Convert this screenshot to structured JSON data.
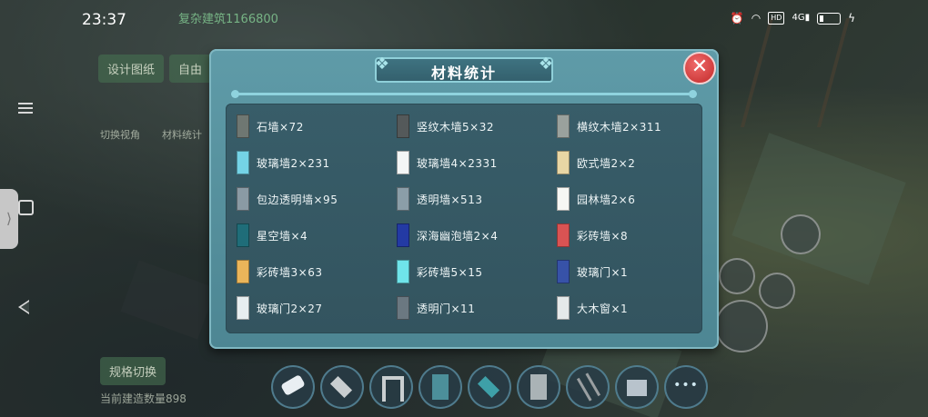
{
  "status_bar": {
    "time": "23:37",
    "icons": [
      "alarm-icon",
      "wifi-icon",
      "hd-icon",
      "signal-4g-icon",
      "battery-icon",
      "charging-icon"
    ]
  },
  "modal": {
    "title": "材料统计",
    "close_label": "✕",
    "items": [
      {
        "label": "石墙×72",
        "color": "#6f7772",
        "icon": "stone-wall-icon"
      },
      {
        "label": "竖纹木墙5×32",
        "color": "#54595a",
        "icon": "vertical-wood-wall-icon"
      },
      {
        "label": "横纹木墙2×311",
        "color": "#9aa19d",
        "icon": "horizontal-wood-wall-icon"
      },
      {
        "label": "玻璃墙2×231",
        "color": "#74d3e6",
        "icon": "glass-wall-icon"
      },
      {
        "label": "玻璃墙4×2331",
        "color": "#f3f6f6",
        "icon": "glass-wall-icon"
      },
      {
        "label": "欧式墙2×2",
        "color": "#e8d6a4",
        "icon": "european-wall-icon"
      },
      {
        "label": "包边透明墙×95",
        "color": "#8a9aa4",
        "icon": "edged-transparent-wall-icon"
      },
      {
        "label": "透明墙×513",
        "color": "#8b9ea8",
        "icon": "transparent-wall-icon"
      },
      {
        "label": "园林墙2×6",
        "color": "#f6f7f4",
        "icon": "garden-wall-icon"
      },
      {
        "label": "星空墙×4",
        "color": "#1f6d79",
        "icon": "starry-wall-icon"
      },
      {
        "label": "深海幽泡墙2×4",
        "color": "#233aa4",
        "icon": "deep-sea-wall-icon"
      },
      {
        "label": "彩砖墙×8",
        "color": "#d95353",
        "icon": "colored-brick-wall-icon"
      },
      {
        "label": "彩砖墙3×63",
        "color": "#eab55a",
        "icon": "colored-brick-wall-icon"
      },
      {
        "label": "彩砖墙5×15",
        "color": "#6fe4ea",
        "icon": "colored-brick-wall-icon"
      },
      {
        "label": "玻璃门×1",
        "color": "#3752a8",
        "icon": "glass-door-icon"
      },
      {
        "label": "玻璃门2×27",
        "color": "#e7eef0",
        "icon": "glass-door-icon"
      },
      {
        "label": "透明门×11",
        "color": "#6b7881",
        "icon": "transparent-door-icon"
      },
      {
        "label": "大木窗×1",
        "color": "#e5e9ea",
        "icon": "big-wood-window-icon"
      }
    ]
  },
  "background": {
    "top_label": "复杂建筑1166800",
    "btn_left": "设计图纸",
    "btn_right": "自由",
    "sub_left": "切换视角",
    "sub_right": "材料统计",
    "bottom_btn": "规格切换",
    "bottom_text": "当前建造数量898"
  },
  "toolbar": {
    "tools": [
      "eraser-icon",
      "floor-tile-icon",
      "door-frame-icon",
      "wall-block-icon",
      "floor-teal-icon",
      "panel-icon",
      "ladder-icon",
      "castle-icon",
      "more-icon"
    ],
    "more_label": "•••"
  }
}
